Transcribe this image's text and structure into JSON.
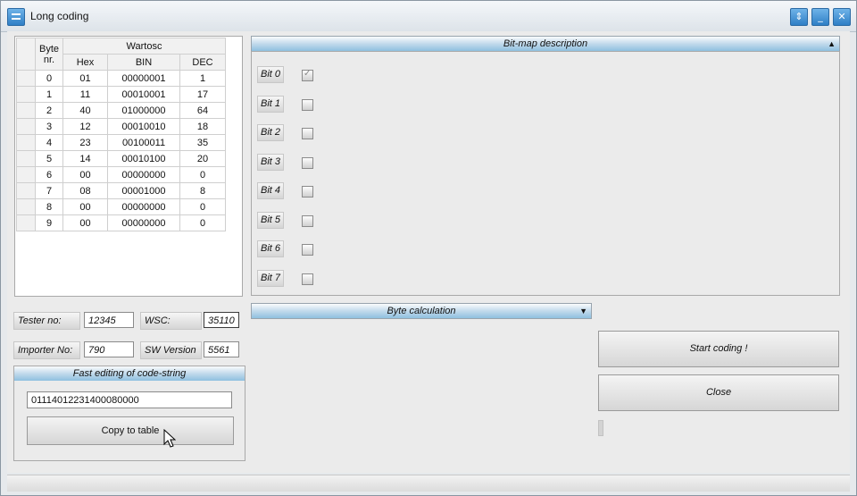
{
  "window": {
    "title": "Long coding",
    "controls": [
      "restore",
      "minimize",
      "close"
    ]
  },
  "table": {
    "header_byte": "Byte",
    "header_byte2": "nr.",
    "header_group": "Wartosc",
    "columns": [
      "Hex",
      "BIN",
      "DEC"
    ],
    "rows": [
      {
        "byte": "0",
        "hex": "01",
        "bin": "00000001",
        "dec": "1"
      },
      {
        "byte": "1",
        "hex": "11",
        "bin": "00010001",
        "dec": "17"
      },
      {
        "byte": "2",
        "hex": "40",
        "bin": "01000000",
        "dec": "64"
      },
      {
        "byte": "3",
        "hex": "12",
        "bin": "00010010",
        "dec": "18"
      },
      {
        "byte": "4",
        "hex": "23",
        "bin": "00100011",
        "dec": "35"
      },
      {
        "byte": "5",
        "hex": "14",
        "bin": "00010100",
        "dec": "20"
      },
      {
        "byte": "6",
        "hex": "00",
        "bin": "00000000",
        "dec": "0"
      },
      {
        "byte": "7",
        "hex": "08",
        "bin": "00001000",
        "dec": "8"
      },
      {
        "byte": "8",
        "hex": "00",
        "bin": "00000000",
        "dec": "0"
      },
      {
        "byte": "9",
        "hex": "00",
        "bin": "00000000",
        "dec": "0"
      }
    ]
  },
  "bitmap": {
    "header": "Bit-map description",
    "bits": [
      {
        "label": "Bit 0",
        "checked": true
      },
      {
        "label": "Bit 1",
        "checked": false
      },
      {
        "label": "Bit 2",
        "checked": false
      },
      {
        "label": "Bit 3",
        "checked": false
      },
      {
        "label": "Bit 4",
        "checked": false
      },
      {
        "label": "Bit 5",
        "checked": false
      },
      {
        "label": "Bit 6",
        "checked": false
      },
      {
        "label": "Bit 7",
        "checked": false
      }
    ]
  },
  "fields": {
    "tester_label": "Tester no:",
    "tester_value": "12345",
    "wsc_label": "WSC:",
    "wsc_value": "35110",
    "importer_label": "Importer No:",
    "importer_value": "790",
    "sw_label": "SW Version",
    "sw_value": "5561"
  },
  "byte_calc": {
    "header": "Byte calculation"
  },
  "fast_edit": {
    "header": "Fast editing of code-string",
    "code_value": "01114012231400080000",
    "copy_label": "Copy to table"
  },
  "actions": {
    "start_label": "Start coding !",
    "close_label": "Close"
  },
  "colors": {
    "accent": "#8fc0e0",
    "window_bg": "#ebebeb"
  }
}
